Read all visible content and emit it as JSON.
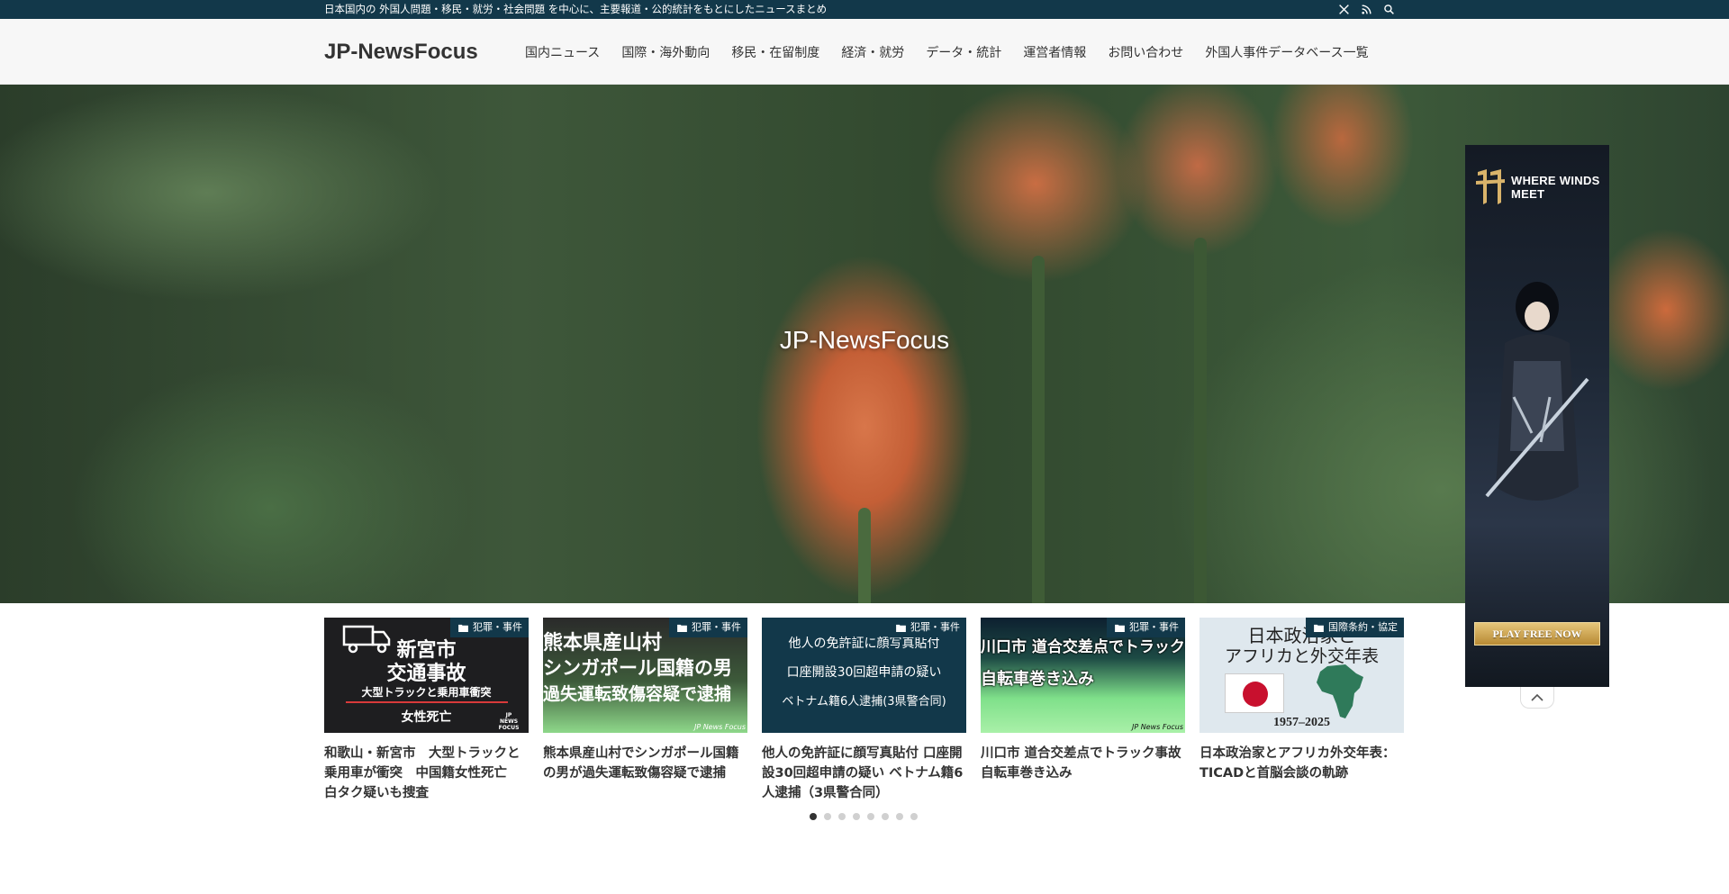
{
  "topbar": {
    "tagline": "日本国内の 外国人問題・移民・就労・社会問題 を中心に、主要報道・公的統計をもとにしたニュースまとめ",
    "icons": [
      "x-icon",
      "rss-icon",
      "search-icon"
    ]
  },
  "header": {
    "site_name": "JP-NewsFocus",
    "nav": [
      "国内ニュース",
      "国際・海外動向",
      "移民・在留制度",
      "経済・就労",
      "データ・統計",
      "運営者情報",
      "お問い合わせ",
      "外国人事件データベース一覧"
    ]
  },
  "hero": {
    "title": "JP-NewsFocus"
  },
  "ad": {
    "brand": "WHERE WINDS MEET",
    "cta": "PLAY FREE NOW"
  },
  "cards": [
    {
      "category": "犯罪・事件",
      "title": "和歌山・新宮市　大型トラックと乗用車が衝突　中国籍女性死亡　白タク疑いも捜査",
      "thumb_lines": [
        "新宮市",
        "交通事故",
        "大型トラックと乗用車衝突",
        "女性死亡"
      ],
      "thumb_mark": "JP NEWS FOCUS"
    },
    {
      "category": "犯罪・事件",
      "title": "熊本県産山村でシンガポール国籍の男が過失運転致傷容疑で逮捕",
      "thumb_lines": [
        "熊本県産山村",
        "シンガポール国籍の男",
        "過失運転致傷容疑で逮捕"
      ],
      "thumb_mark": "JP News Focus"
    },
    {
      "category": "犯罪・事件",
      "title": "他人の免許証に顔写真貼付 口座開設30回超申請の疑い ベトナム籍6人逮捕（3県警合同）",
      "thumb_lines": [
        "他人の免許証に顔写真貼付",
        "口座開設30回超申請の疑い",
        "ベトナム籍6人逮捕(3県警合同)"
      ]
    },
    {
      "category": "犯罪・事件",
      "title": "川口市 道合交差点でトラック事故　自転車巻き込み",
      "thumb_lines": [
        "川口市 道合交差点でトラック事故",
        "自転車巻き込み"
      ],
      "thumb_mark": "JP News Focus"
    },
    {
      "category": "国際条約・協定",
      "title": "日本政治家とアフリカ外交年表：TICADと首脳会談の軌跡",
      "thumb_lines": [
        "日本政治家と",
        "アフリカと外交年表",
        "1957–2025"
      ]
    }
  ],
  "pager": {
    "count": 8,
    "active": 0
  },
  "colors": {
    "topbar": "#12384a",
    "accent": "#12384a"
  }
}
